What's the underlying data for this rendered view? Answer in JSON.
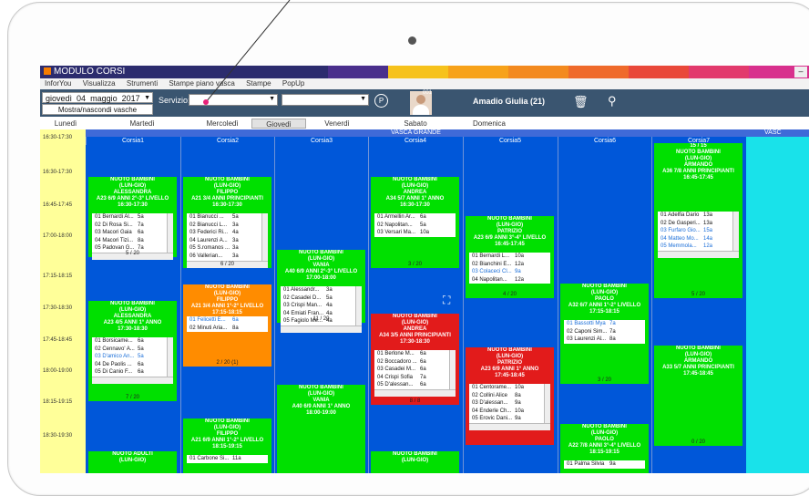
{
  "app": {
    "title": "MODULO CORSI",
    "minimize": "–"
  },
  "menu": [
    "InforYou",
    "Visualizza",
    "Strumenti",
    "Stampe piano vasca",
    "Stampe",
    "PopUp"
  ],
  "toolbar": {
    "date": {
      "weekday": "giovedì",
      "day": "04",
      "month": "maggio",
      "year": "2017"
    },
    "toggle_label": "Mostra/nascondi vasche",
    "service_label": "Servizio:",
    "service_value": "",
    "service2_value": "",
    "p_button": "P",
    "avatar_id": "001",
    "user_name": "Amadio Giulia (21)"
  },
  "days": [
    {
      "label": "Lunedì",
      "active": false
    },
    {
      "label": "Martedì",
      "active": false
    },
    {
      "label": "Mercoledì",
      "active": false
    },
    {
      "label": "Giovedì",
      "active": true
    },
    {
      "label": "Venerdì",
      "active": false
    },
    {
      "label": "Sabato",
      "active": false
    },
    {
      "label": "Domenica",
      "active": false
    }
  ],
  "pool": {
    "name": "VASCA GRANDE",
    "next_pool": "VASC"
  },
  "lanes": [
    "Corsia1",
    "Corsia2",
    "Corsia3",
    "Corsia4",
    "Corsia5",
    "Corsia6",
    "Corsia7"
  ],
  "times": [
    "16:30-17:30",
    "16:30-17:30",
    "16:45-17:45",
    "17:00-18:00",
    "17:15-18:15",
    "17:30-18:30",
    "17:45-18:45",
    "18:00-19:00",
    "18:15-19:15",
    "18:30-19:30"
  ],
  "colors": {
    "blue": "#0057d9",
    "green": "#00e000",
    "orange": "#ff8c00",
    "red": "#e21b1b",
    "cyan": "#19e2ea",
    "time": "#ffff99"
  },
  "blocks": [
    {
      "lane": 0,
      "color": "green",
      "header": [
        "NUOTO BAMBINI",
        "(LUN-GIO)",
        "ALESSANDRA",
        "A23 6/9 ANNI 2°-3° LIVELLO",
        "16:30-17:30"
      ],
      "rows": [
        {
          "t": "01 Bernardi Al...",
          "a": "5a"
        },
        {
          "t": "02 Di Rosa Si...",
          "a": "7a"
        },
        {
          "t": "03 Macori Gaia",
          "a": "6a"
        },
        {
          "t": "04 Macori Tizi...",
          "a": "8a"
        },
        {
          "t": "05 Padovan G...",
          "a": "7a"
        }
      ],
      "count": "5 / 20"
    },
    {
      "lane": 0,
      "color": "green",
      "header": [
        "NUOTO BAMBINI",
        "(LUN-GIO)",
        "ALESSANDRA",
        "A23 4/5 ANNI 1° ANNO",
        "17:30-18:30"
      ],
      "rows": [
        {
          "t": "01 Borsicame...",
          "a": "6a"
        },
        {
          "t": "02 Cennavo' A...",
          "a": "5a"
        },
        {
          "t": "03 D'amico An...",
          "a": "5a",
          "blue": true
        },
        {
          "t": "04 De Paolis ...",
          "a": "6a"
        },
        {
          "t": "05 Di Canio F...",
          "a": "6a"
        }
      ],
      "count": "7 / 20"
    },
    {
      "lane": 0,
      "color": "green",
      "header": [
        "NUOTO ADULTI",
        "(LUN-GIO)"
      ],
      "rows": [],
      "count": ""
    },
    {
      "lane": 1,
      "color": "green",
      "header": [
        "NUOTO BAMBINI",
        "(LUN-GIO)",
        "FILIPPO",
        "A21 3/4 ANNI PRINCIPIANTI",
        "16:30-17:30"
      ],
      "rows": [
        {
          "t": "01 Bianucci ...",
          "a": "5a"
        },
        {
          "t": "02 Bianucci L...",
          "a": "3a"
        },
        {
          "t": "03 Federici Ri...",
          "a": "4a"
        },
        {
          "t": "04 Laurenzi A...",
          "a": "3a"
        },
        {
          "t": "05 S.romanos ...",
          "a": "3a"
        },
        {
          "t": "06 Vallerian...",
          "a": "3a"
        }
      ],
      "count": "6 / 20"
    },
    {
      "lane": 1,
      "color": "orange",
      "header": [
        "NUOTO BAMBINI",
        "(LUN-GIO)",
        "FILIPPO",
        "A21 3/4 ANNI 1°-2° LIVELLO",
        "17:15-18:15"
      ],
      "rows": [
        {
          "t": "01 Felicetti E...",
          "a": "6a",
          "blue": true
        },
        {
          "t": "02 Minuti Aria...",
          "a": "8a"
        }
      ],
      "count": "2 / 20 (1)"
    },
    {
      "lane": 1,
      "color": "green",
      "header": [
        "NUOTO BAMBINI",
        "(LUN-GIO)",
        "FILIPPO",
        "A21 6/9 ANNI 1°-2° LIVELLO",
        "18:15-19:15"
      ],
      "rows": [
        {
          "t": "01 Carbone Si...",
          "a": "11a"
        }
      ],
      "count": ""
    },
    {
      "lane": 2,
      "color": "green",
      "header": [
        "NUOTO BAMBINI",
        "(LUN-GIO)",
        "VANIA",
        "A40 6/9 ANNI 2°-3° LIVELLO",
        "17:00-18:00"
      ],
      "rows": [
        {
          "t": "01 Alessandr...",
          "a": "3a"
        },
        {
          "t": "02 Casadei D...",
          "a": "5a"
        },
        {
          "t": "03 Crispi Man...",
          "a": "4a"
        },
        {
          "t": "04 Emiati Fran...",
          "a": "4a"
        },
        {
          "t": "05 Fagiolo Me...",
          "a": "4a"
        }
      ],
      "count": "11 / 20"
    },
    {
      "lane": 2,
      "color": "green",
      "header": [
        "NUOTO BAMBINI",
        "(LUN-GIO)",
        "VANIA",
        "A40 6/9 ANNI 1° ANNO",
        "18:00-19:00"
      ],
      "rows": [],
      "count": ""
    },
    {
      "lane": 3,
      "color": "green",
      "header": [
        "NUOTO BAMBINI",
        "(LUN-GIO)",
        "ANDREA",
        "A34 5/7 ANNI 1° ANNO",
        "16:30-17:30"
      ],
      "rows": [
        {
          "t": "01 Armellin Ar...",
          "a": "6a"
        },
        {
          "t": "02 Napolitan...",
          "a": "5a"
        },
        {
          "t": "03 Versari Ma...",
          "a": "10a"
        }
      ],
      "count": "3 / 20"
    },
    {
      "lane": 3,
      "color": "red",
      "header": [
        "NUOTO BAMBINI",
        "(LUN-GIO)",
        "ANDREA",
        "A34 3/5 ANNI PRINCIPIANTI",
        "17:30-18:30"
      ],
      "rows": [
        {
          "t": "01 Berlone M...",
          "a": "6a"
        },
        {
          "t": "02 Boccadoro ...",
          "a": "6a"
        },
        {
          "t": "03 Casadei M...",
          "a": "6a"
        },
        {
          "t": "04 Crispi Sofia",
          "a": "7a"
        },
        {
          "t": "05 D'alessan...",
          "a": "6a"
        }
      ],
      "count": "8 / 8"
    },
    {
      "lane": 3,
      "color": "green",
      "header": [
        "NUOTO BAMBINI",
        "(LUN-GIO)"
      ],
      "rows": [],
      "count": ""
    },
    {
      "lane": 4,
      "color": "green",
      "header": [
        "NUOTO BAMBINI",
        "(LUN-GIO)",
        "PATRIZIO",
        "A23 6/9 ANNI 3°-4° LIVELLO",
        "16:45-17:45"
      ],
      "rows": [
        {
          "t": "01 Bernardi L...",
          "a": "10a"
        },
        {
          "t": "02 Bianchini E...",
          "a": "12a"
        },
        {
          "t": "03 Colaceci Cl...",
          "a": "9a",
          "blue": true
        },
        {
          "t": "04 Napolitan...",
          "a": "12a"
        }
      ],
      "count": "4 / 20"
    },
    {
      "lane": 4,
      "color": "red",
      "header": [
        "NUOTO BAMBINI",
        "(LUN-GIO)",
        "PATRIZIO",
        "A23 6/9 ANNI 1° ANNO",
        "17:45-18:45"
      ],
      "rows": [
        {
          "t": "01 Centorame...",
          "a": "10a"
        },
        {
          "t": "02 Collini Alice",
          "a": "8a"
        },
        {
          "t": "03 D'alessan...",
          "a": "9a"
        },
        {
          "t": "04 Enderle Ch...",
          "a": "10a"
        },
        {
          "t": "05 Erovic Dani...",
          "a": "9a"
        }
      ],
      "count": ""
    },
    {
      "lane": 5,
      "color": "green",
      "header": [
        "NUOTO BAMBINI",
        "(LUN-GIO)",
        "PAOLO",
        "A32 6/7 ANNI 1°-2° LIVELLO",
        "17:15-18:15"
      ],
      "rows": [
        {
          "t": "01 Bassotti Mya",
          "a": "7a",
          "blue": true
        },
        {
          "t": "02 Caponi Sim...",
          "a": "7a"
        },
        {
          "t": "03 Laurenzi Al...",
          "a": "8a"
        }
      ],
      "count": "3 / 20"
    },
    {
      "lane": 5,
      "color": "green",
      "header": [
        "NUOTO BAMBINI",
        "(LUN-GIO)",
        "PAOLO",
        "A22 7/8 ANNI 3°-4° LIVELLO",
        "18:15-19:15"
      ],
      "rows": [
        {
          "t": "01 Palma Silvia",
          "a": "9a"
        }
      ],
      "count": ""
    },
    {
      "lane": 6,
      "color": "green",
      "header": [
        "15 / 15",
        "NUOTO BAMBINI",
        "(LUN-GIO)",
        "ARMANDO",
        "A36 7/8 ANNI PRINCIPIANTI",
        "16:45-17:45"
      ],
      "rows": [
        {
          "t": "01 Adelfia Dario",
          "a": "13a"
        },
        {
          "t": "02 De Gasperi...",
          "a": "13a"
        },
        {
          "t": "03 Furfaro Gio...",
          "a": "15a",
          "blue": true
        },
        {
          "t": "04 Matteo Mo...",
          "a": "14a",
          "blue": true
        },
        {
          "t": "05 Memmola...",
          "a": "12a",
          "blue": true
        }
      ],
      "count": "5 / 20"
    },
    {
      "lane": 6,
      "color": "green",
      "header": [
        "NUOTO BAMBINI",
        "(LUN-GIO)",
        "ARMANDO",
        "A33 5/7 ANNI PRINCIPIANTI",
        "17:45-18:45"
      ],
      "rows": [],
      "count": "0 / 20"
    }
  ]
}
